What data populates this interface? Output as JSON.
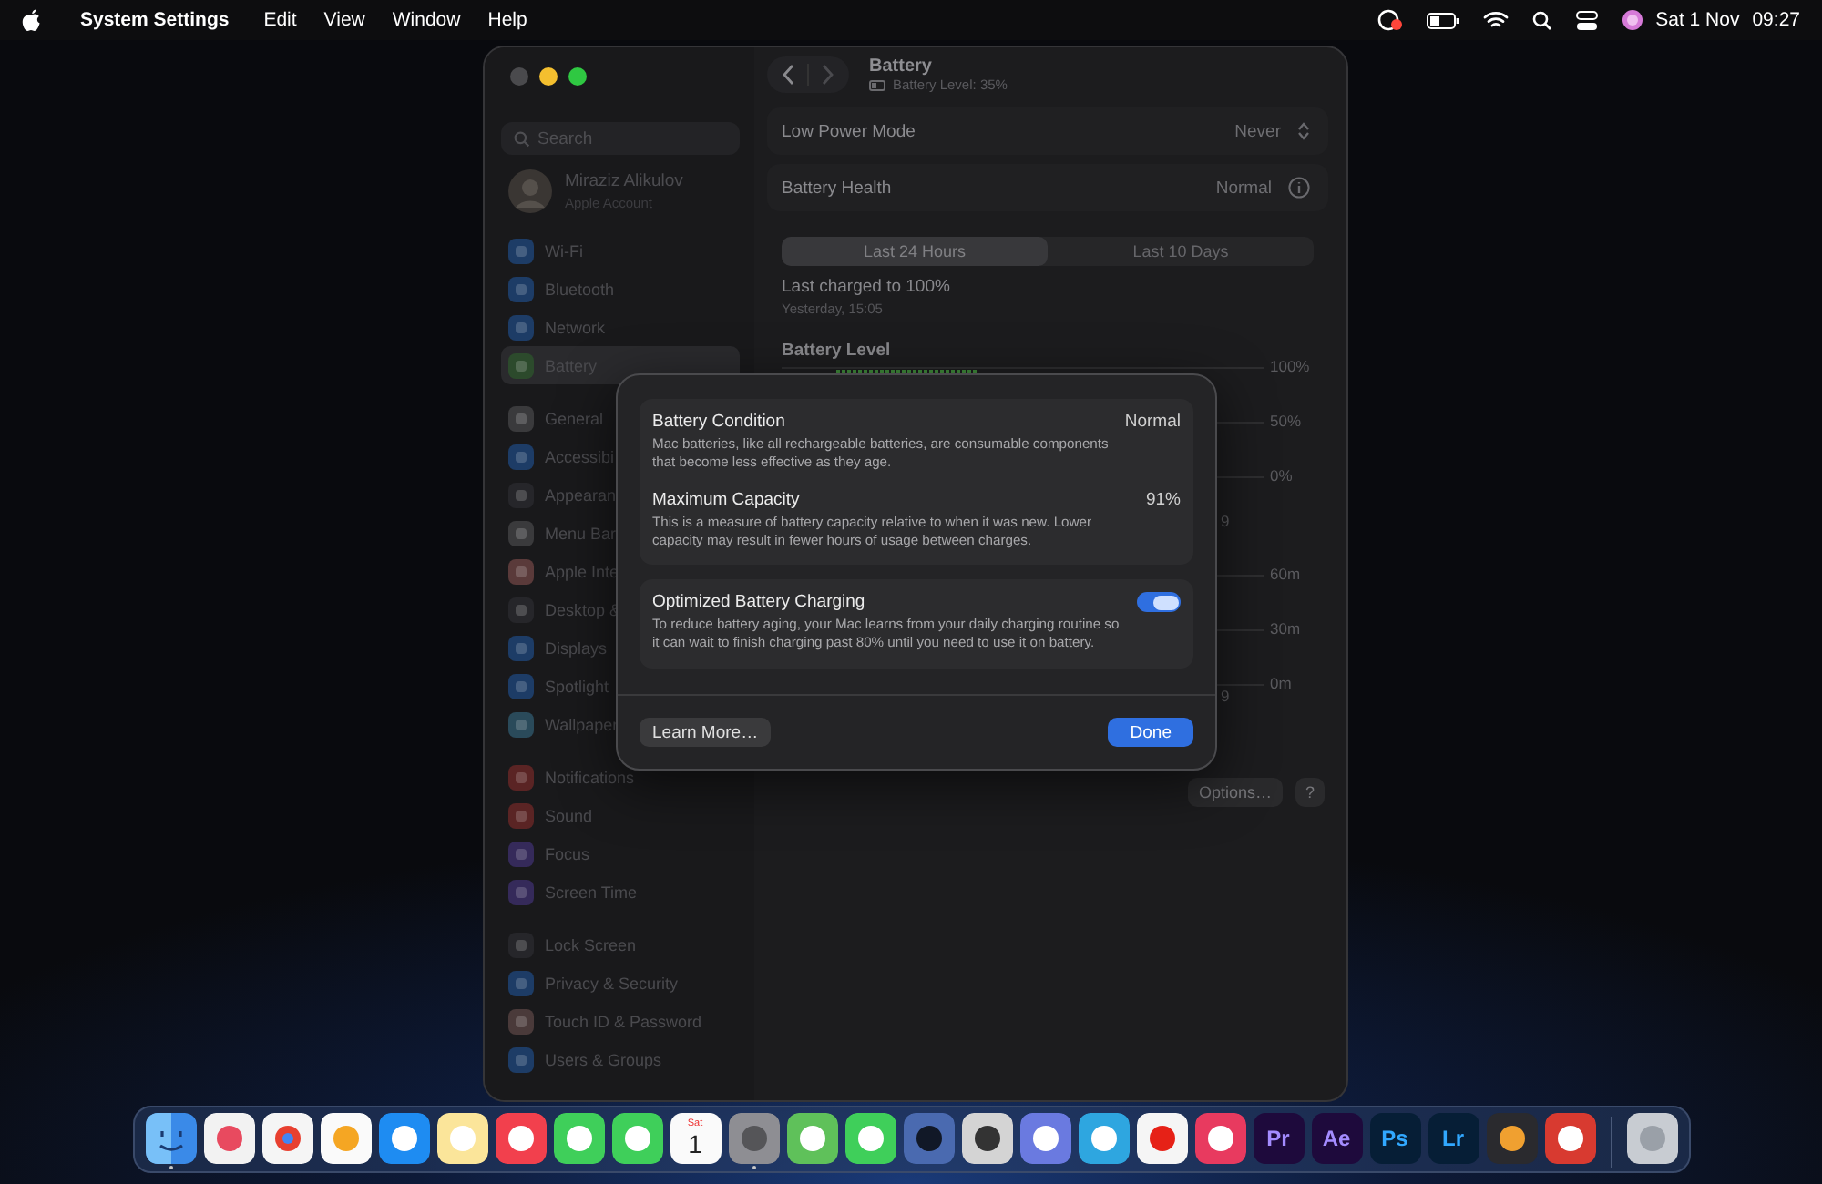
{
  "menubar": {
    "app": "System Settings",
    "menus": [
      "Edit",
      "View",
      "Window",
      "Help"
    ],
    "date": "Sat 1 Nov",
    "time": "09:27"
  },
  "sidebar": {
    "search": {
      "placeholder": "Search"
    },
    "account": {
      "name": "Miraziz Alikulov",
      "subtitle": "Apple Account"
    },
    "groups": [
      {
        "items": [
          {
            "label": "Wi-Fi",
            "kind": "wifi",
            "selected": false
          },
          {
            "label": "Bluetooth",
            "kind": "bluetooth",
            "selected": false
          },
          {
            "label": "Network",
            "kind": "network",
            "selected": false
          },
          {
            "label": "Battery",
            "kind": "battery",
            "selected": true
          }
        ]
      },
      {
        "items": [
          {
            "label": "General",
            "kind": "general",
            "selected": false
          },
          {
            "label": "Accessibi",
            "kind": "accessibility",
            "selected": false
          },
          {
            "label": "Appearan",
            "kind": "appearance",
            "selected": false
          },
          {
            "label": "Menu Bar",
            "kind": "menubar",
            "selected": false
          },
          {
            "label": "Apple Inte",
            "kind": "intelligence",
            "selected": false
          },
          {
            "label": "Desktop &",
            "kind": "desktop",
            "selected": false
          },
          {
            "label": "Displays",
            "kind": "displays",
            "selected": false
          },
          {
            "label": "Spotlight",
            "kind": "spotlight",
            "selected": false
          },
          {
            "label": "Wallpaper",
            "kind": "wallpaper",
            "selected": false
          }
        ]
      },
      {
        "items": [
          {
            "label": "Notifications",
            "kind": "notifications",
            "selected": false
          },
          {
            "label": "Sound",
            "kind": "sound",
            "selected": false
          },
          {
            "label": "Focus",
            "kind": "focus",
            "selected": false
          },
          {
            "label": "Screen Time",
            "kind": "screentime",
            "selected": false
          }
        ]
      },
      {
        "items": [
          {
            "label": "Lock Screen",
            "kind": "lock",
            "selected": false
          },
          {
            "label": "Privacy & Security",
            "kind": "privacy",
            "selected": false
          },
          {
            "label": "Touch ID & Password",
            "kind": "touchid",
            "selected": false
          },
          {
            "label": "Users & Groups",
            "kind": "users",
            "selected": false
          }
        ]
      }
    ]
  },
  "header": {
    "title": "Battery",
    "subtitle": "Battery Level: 35%"
  },
  "settings": [
    {
      "label": "Low Power Mode",
      "value": "Never",
      "kind": "popup"
    },
    {
      "label": "Battery Health",
      "value": "Normal",
      "kind": "info"
    }
  ],
  "range_tabs": [
    {
      "label": "Last 24 Hours",
      "selected": true
    },
    {
      "label": "Last 10 Days",
      "selected": false
    }
  ],
  "last_charged": {
    "title": "Last charged to 100%",
    "time": "Yesterday, 15:05"
  },
  "battery_level": {
    "title": "Battery Level",
    "axis": [
      "100%",
      "50%",
      "0%"
    ],
    "x_label": "9"
  },
  "usage": {
    "axis": [
      "60m",
      "30m",
      "0m"
    ],
    "x_label": "9"
  },
  "pane_buttons": [
    {
      "label": "Options…",
      "kind": "text"
    },
    {
      "label": "?",
      "kind": "help"
    }
  ],
  "dialog": {
    "cards": [
      {
        "rows": [
          {
            "title": "Battery Condition",
            "value": "Normal",
            "kind": "value",
            "description": "Mac batteries, like all rechargeable batteries, are consumable components that become less effective as they age."
          },
          {
            "title": "Maximum Capacity",
            "value": "91%",
            "kind": "value",
            "description": "This is a measure of battery capacity relative to when it was new. Lower capacity may result in fewer hours of usage between charges."
          }
        ]
      },
      {
        "rows": [
          {
            "title": "Optimized Battery Charging",
            "kind": "toggle",
            "on": true,
            "description": "To reduce battery aging, your Mac learns from your daily charging routine so it can wait to finish charging past 80% until you need to use it on battery."
          }
        ]
      }
    ],
    "buttons": [
      {
        "label": "Learn More…",
        "kind": "secondary"
      },
      {
        "label": "Done",
        "kind": "primary"
      }
    ]
  },
  "dock": [
    {
      "kind": "finder",
      "running": true
    },
    {
      "kind": "launchpad",
      "running": false
    },
    {
      "kind": "chrome",
      "running": false
    },
    {
      "kind": "photos",
      "running": false
    },
    {
      "kind": "appstore",
      "running": false
    },
    {
      "kind": "notes",
      "running": false
    },
    {
      "kind": "music",
      "running": false
    },
    {
      "kind": "facetime",
      "running": false
    },
    {
      "kind": "messages",
      "running": false
    },
    {
      "kind": "calendar",
      "top": "Sat",
      "label": "1",
      "running": false
    },
    {
      "kind": "settings",
      "running": true
    },
    {
      "kind": "findmy",
      "running": false
    },
    {
      "kind": "phone",
      "running": false
    },
    {
      "kind": "jar",
      "running": false
    },
    {
      "kind": "calculator",
      "running": false
    },
    {
      "kind": "mirroring",
      "running": false
    },
    {
      "kind": "telegram",
      "running": false
    },
    {
      "kind": "youtube",
      "running": false
    },
    {
      "kind": "cloud",
      "running": false
    },
    {
      "kind": "premiere",
      "label": "Pr",
      "running": false
    },
    {
      "kind": "aftereffects",
      "label": "Ae",
      "running": false
    },
    {
      "kind": "photoshop",
      "label": "Ps",
      "running": false
    },
    {
      "kind": "lightroom",
      "label": "Lr",
      "running": false
    },
    {
      "kind": "davinci",
      "running": false
    },
    {
      "kind": "redapp",
      "running": false
    },
    {
      "kind": "trash",
      "running": false
    }
  ]
}
